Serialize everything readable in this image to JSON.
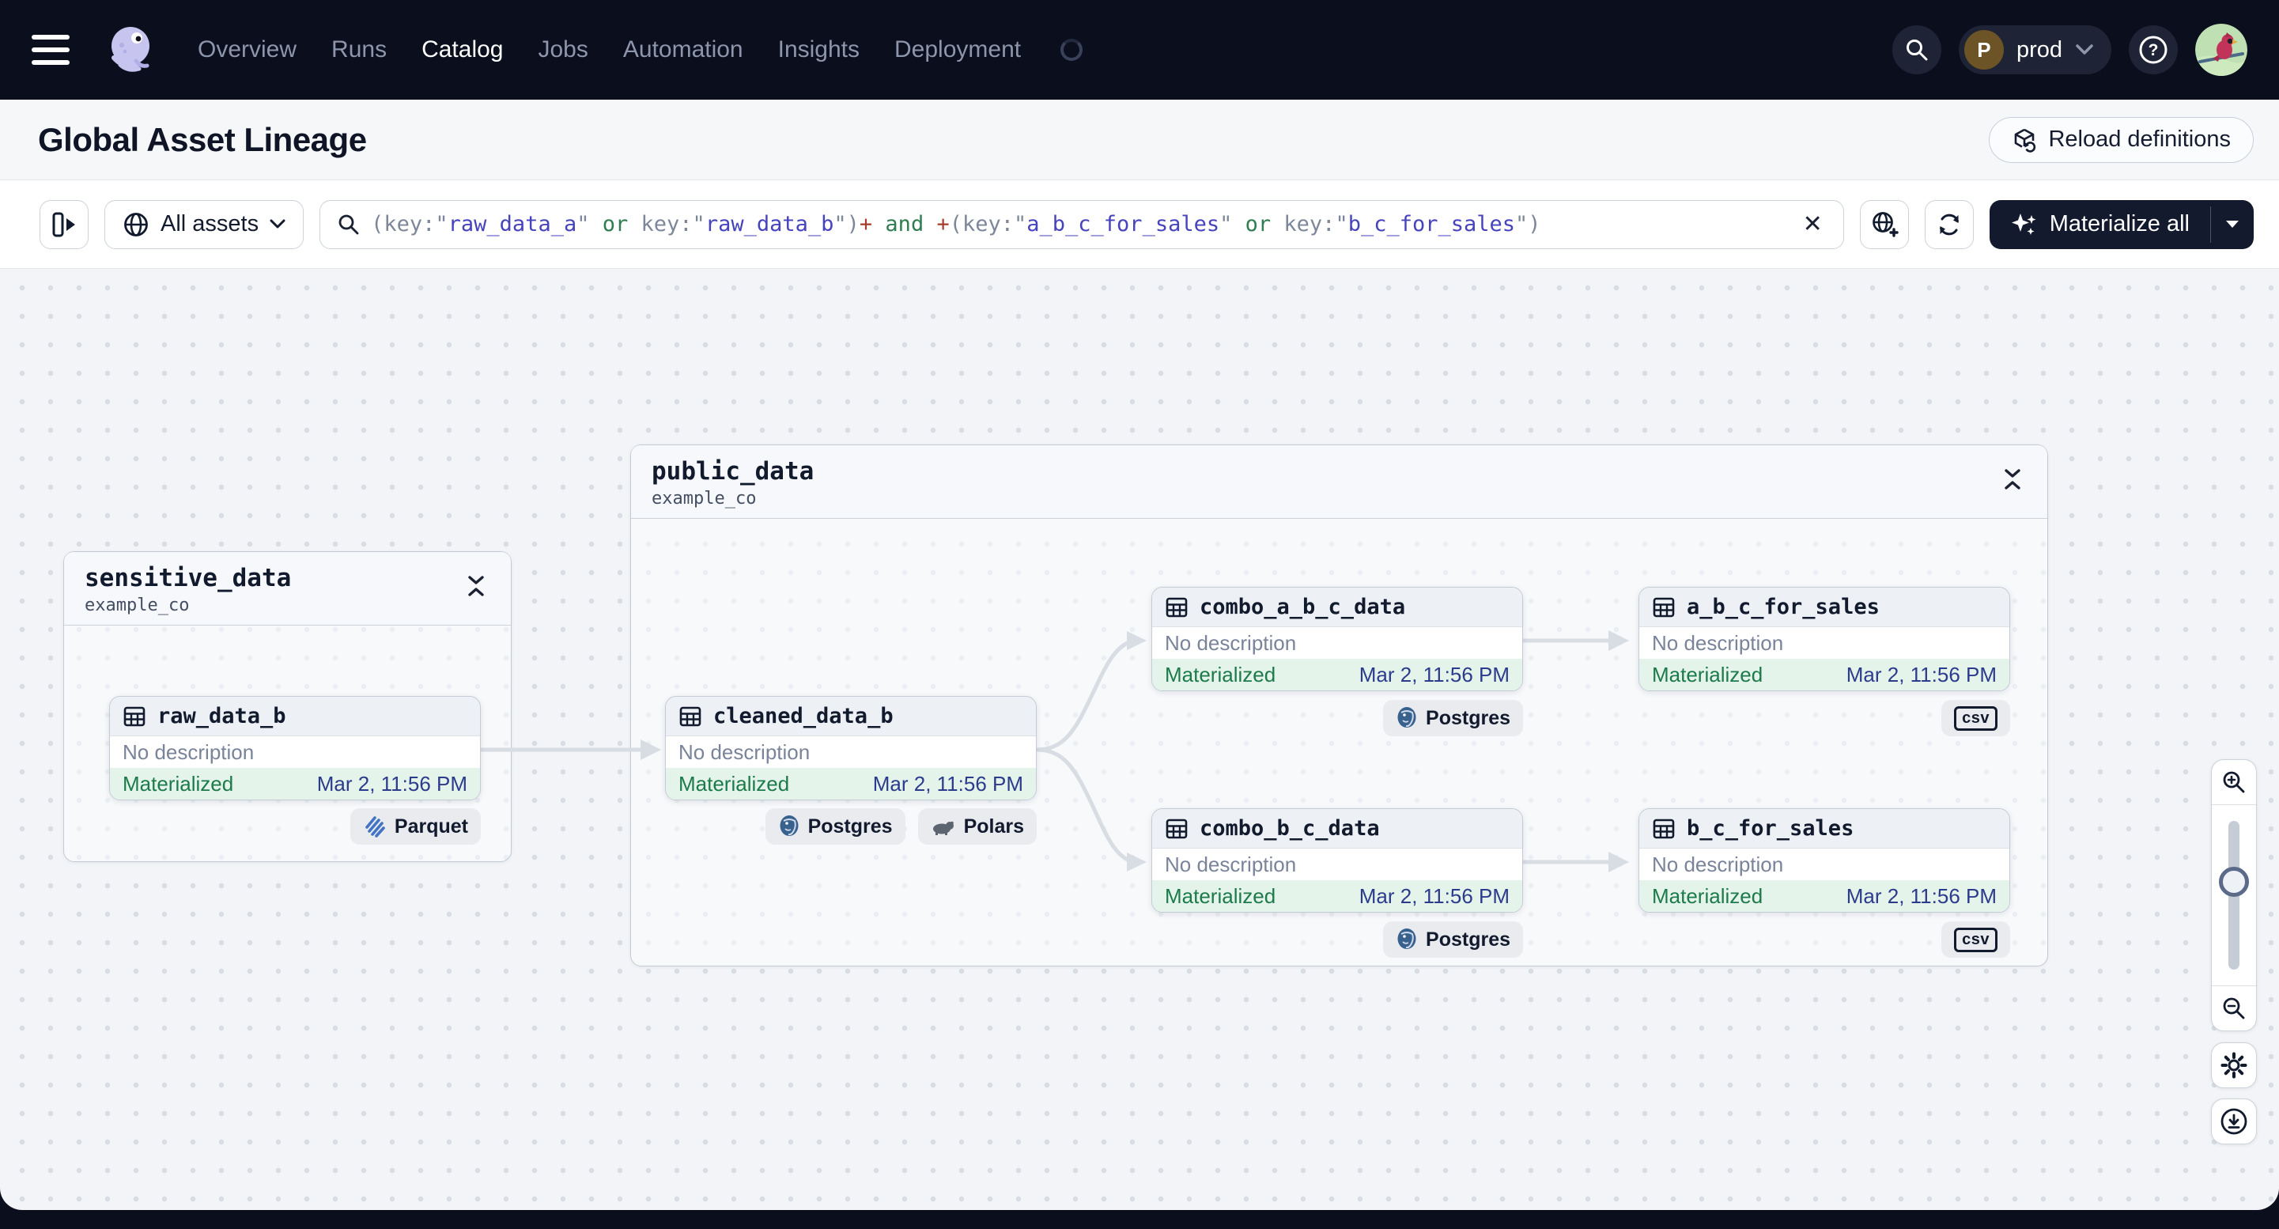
{
  "nav": {
    "items": [
      {
        "label": "Overview",
        "active": false
      },
      {
        "label": "Runs",
        "active": false
      },
      {
        "label": "Catalog",
        "active": true
      },
      {
        "label": "Jobs",
        "active": false
      },
      {
        "label": "Automation",
        "active": false
      },
      {
        "label": "Insights",
        "active": false
      },
      {
        "label": "Deployment",
        "active": false
      }
    ],
    "deployment_switcher": {
      "initial": "P",
      "name": "prod"
    }
  },
  "page": {
    "title": "Global Asset Lineage",
    "reload_definitions_label": "Reload definitions"
  },
  "toolbar": {
    "scope_label": "All assets",
    "materialize_label": "Materialize all",
    "query_tokens": [
      [
        "(key:",
        "punct"
      ],
      [
        "\"",
        "punct"
      ],
      [
        "raw_data_a",
        "value"
      ],
      [
        "\"",
        "punct"
      ],
      [
        " ",
        "punct"
      ],
      [
        "or",
        "op"
      ],
      [
        " key:",
        "punct"
      ],
      [
        "\"",
        "punct"
      ],
      [
        "raw_data_b",
        "value"
      ],
      [
        "\"",
        "punct"
      ],
      [
        ")",
        "punct"
      ],
      [
        "+",
        "plus"
      ],
      [
        " and ",
        "op"
      ],
      [
        "+",
        "plus"
      ],
      [
        "(key:",
        "punct"
      ],
      [
        "\"",
        "punct"
      ],
      [
        "a_b_c_for_sales",
        "value"
      ],
      [
        "\"",
        "punct"
      ],
      [
        " ",
        "punct"
      ],
      [
        "or",
        "op"
      ],
      [
        " key:",
        "punct"
      ],
      [
        "\"",
        "punct"
      ],
      [
        "b_c_for_sales",
        "value"
      ],
      [
        "\"",
        "punct"
      ],
      [
        ")",
        "punct"
      ]
    ]
  },
  "graph": {
    "groups": [
      {
        "name": "sensitive_data",
        "location": "example_co"
      },
      {
        "name": "public_data",
        "location": "example_co"
      }
    ],
    "nodes": [
      {
        "name": "raw_data_b",
        "description": "No description",
        "status": "Materialized",
        "timestamp": "Mar 2, 11:56 PM"
      },
      {
        "name": "cleaned_data_b",
        "description": "No description",
        "status": "Materialized",
        "timestamp": "Mar 2, 11:56 PM"
      },
      {
        "name": "combo_a_b_c_data",
        "description": "No description",
        "status": "Materialized",
        "timestamp": "Mar 2, 11:56 PM"
      },
      {
        "name": "a_b_c_for_sales",
        "description": "No description",
        "status": "Materialized",
        "timestamp": "Mar 2, 11:56 PM"
      },
      {
        "name": "combo_b_c_data",
        "description": "No description",
        "status": "Materialized",
        "timestamp": "Mar 2, 11:56 PM"
      },
      {
        "name": "b_c_for_sales",
        "description": "No description",
        "status": "Materialized",
        "timestamp": "Mar 2, 11:56 PM"
      }
    ],
    "tags": {
      "parquet": "Parquet",
      "postgres": "Postgres",
      "polars": "Polars",
      "csv": "csv"
    }
  }
}
